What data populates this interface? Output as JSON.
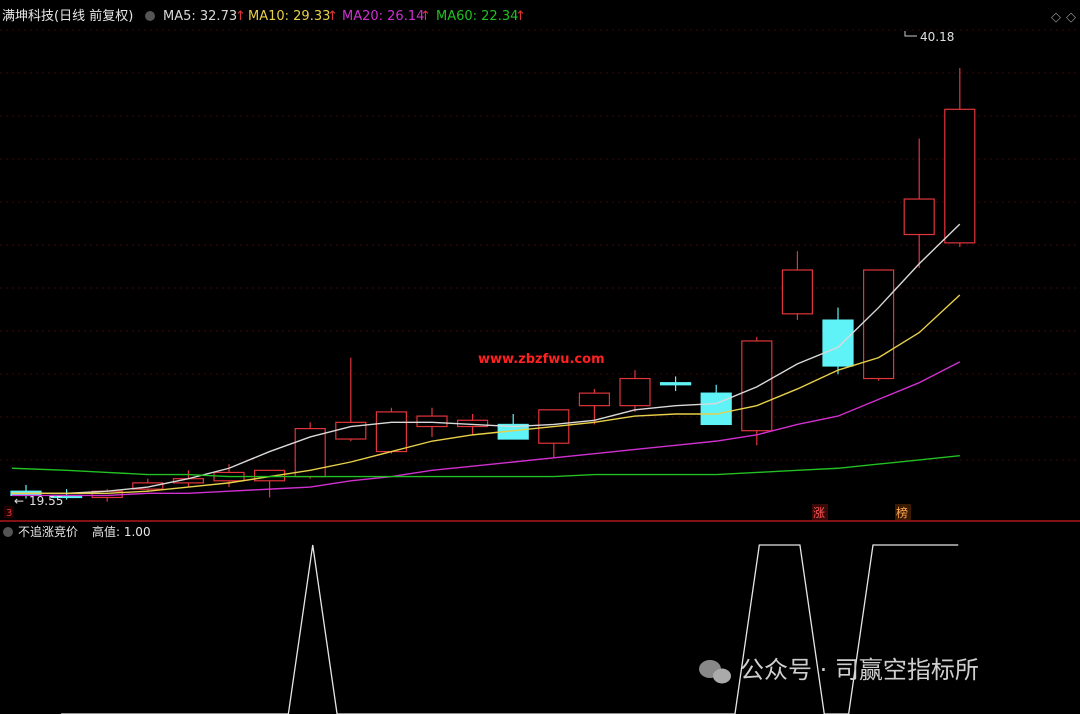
{
  "header": {
    "stock_title": "满坤科技(日线 前复权)",
    "ma5_label": "MA5: 32.73",
    "ma10_label": "MA10: 29.33",
    "ma20_label": "MA20: 26.14",
    "ma60_label": "MA60: 22.34",
    "up_arrow": "↑"
  },
  "labels": {
    "high_price": "40.18",
    "low_price": "19.55",
    "watermark_site": "www.zbzfwu.com",
    "tag_zhang": "涨",
    "tag_bang": "榜",
    "left_marker": "3"
  },
  "indicator": {
    "title": "不追涨竞价",
    "value_label": "高值: 1.00"
  },
  "watermark": {
    "text": "公众号 · 司赢空指标所"
  },
  "colors": {
    "up": "#e0353a",
    "down": "#5ff3f7",
    "ma5": "#d9d9d9",
    "ma10": "#e8d04a",
    "ma20": "#d030d0",
    "ma60": "#22c022",
    "indicator_line": "#e6e6e6",
    "grid": "#7a1010"
  },
  "chart_data": {
    "type": "candlestick",
    "price_range": [
      19.0,
      42.0
    ],
    "candles": [
      {
        "o": 19.9,
        "h": 20.2,
        "l": 19.55,
        "c": 19.7
      },
      {
        "o": 19.7,
        "h": 20.0,
        "l": 19.5,
        "c": 19.6
      },
      {
        "o": 19.6,
        "h": 20.0,
        "l": 19.4,
        "c": 19.9
      },
      {
        "o": 20.0,
        "h": 20.5,
        "l": 19.9,
        "c": 20.3
      },
      {
        "o": 20.3,
        "h": 20.9,
        "l": 20.1,
        "c": 20.5
      },
      {
        "o": 20.4,
        "h": 21.2,
        "l": 20.1,
        "c": 20.8
      },
      {
        "o": 20.4,
        "h": 20.9,
        "l": 19.6,
        "c": 20.9
      },
      {
        "o": 20.6,
        "h": 23.2,
        "l": 20.5,
        "c": 22.9
      },
      {
        "o": 22.4,
        "h": 26.3,
        "l": 22.3,
        "c": 23.2
      },
      {
        "o": 21.8,
        "h": 23.9,
        "l": 21.7,
        "c": 23.7
      },
      {
        "o": 23.0,
        "h": 23.9,
        "l": 22.5,
        "c": 23.5
      },
      {
        "o": 23.0,
        "h": 23.6,
        "l": 22.6,
        "c": 23.3
      },
      {
        "o": 23.1,
        "h": 23.6,
        "l": 22.5,
        "c": 22.4
      },
      {
        "o": 22.2,
        "h": 23.8,
        "l": 21.5,
        "c": 23.8
      },
      {
        "o": 24.0,
        "h": 24.8,
        "l": 23.1,
        "c": 24.6
      },
      {
        "o": 24.0,
        "h": 25.7,
        "l": 23.7,
        "c": 25.3
      },
      {
        "o": 25.1,
        "h": 25.4,
        "l": 24.7,
        "c": 25.0
      },
      {
        "o": 24.6,
        "h": 25.0,
        "l": 23.1,
        "c": 23.1
      },
      {
        "o": 22.8,
        "h": 27.3,
        "l": 22.1,
        "c": 27.1
      },
      {
        "o": 28.4,
        "h": 31.4,
        "l": 28.1,
        "c": 30.5
      },
      {
        "o": 28.1,
        "h": 28.7,
        "l": 25.5,
        "c": 25.9
      },
      {
        "o": 25.3,
        "h": 30.5,
        "l": 25.2,
        "c": 30.5
      },
      {
        "o": 32.2,
        "h": 36.8,
        "l": 30.6,
        "c": 33.9
      },
      {
        "o": 31.8,
        "h": 40.18,
        "l": 31.6,
        "c": 38.2
      }
    ],
    "ma": [
      {
        "name": "MA5",
        "color_key": "ma5",
        "values": [
          19.8,
          19.8,
          19.9,
          20.1,
          20.5,
          21.0,
          21.8,
          22.5,
          23.0,
          23.2,
          23.2,
          23.1,
          23.0,
          23.1,
          23.3,
          23.8,
          24.0,
          24.1,
          24.9,
          26.0,
          26.8,
          28.7,
          30.8,
          32.7
        ]
      },
      {
        "name": "MA10",
        "color_key": "ma10",
        "values": [
          19.8,
          19.8,
          19.8,
          19.9,
          20.1,
          20.3,
          20.6,
          20.9,
          21.3,
          21.8,
          22.3,
          22.6,
          22.8,
          23.0,
          23.2,
          23.5,
          23.6,
          23.6,
          24.0,
          24.8,
          25.7,
          26.3,
          27.5,
          29.3
        ]
      },
      {
        "name": "MA20",
        "color_key": "ma20",
        "values": [
          19.7,
          19.7,
          19.7,
          19.8,
          19.8,
          19.9,
          20.0,
          20.1,
          20.4,
          20.6,
          20.9,
          21.1,
          21.3,
          21.5,
          21.7,
          21.9,
          22.1,
          22.3,
          22.6,
          23.1,
          23.5,
          24.3,
          25.1,
          26.1
        ]
      },
      {
        "name": "MA60",
        "color_key": "ma60",
        "values": [
          21.0,
          20.9,
          20.8,
          20.7,
          20.7,
          20.6,
          20.6,
          20.6,
          20.6,
          20.6,
          20.6,
          20.6,
          20.6,
          20.6,
          20.7,
          20.7,
          20.7,
          20.7,
          20.8,
          20.9,
          21.0,
          21.2,
          21.4,
          21.6
        ]
      }
    ],
    "indicator_range": [
      0,
      1.0
    ],
    "indicator_points": [
      [
        0,
        0
      ],
      [
        1,
        0
      ],
      [
        2,
        0
      ],
      [
        3,
        0
      ],
      [
        4,
        0
      ],
      [
        5,
        0
      ],
      [
        5.6,
        0
      ],
      [
        6.2,
        1.0
      ],
      [
        6.8,
        0
      ],
      [
        7,
        0
      ],
      [
        8,
        0
      ],
      [
        9,
        0
      ],
      [
        10,
        0
      ],
      [
        11,
        0
      ],
      [
        12,
        0
      ],
      [
        13,
        0
      ],
      [
        14,
        0
      ],
      [
        15,
        0
      ],
      [
        16,
        0
      ],
      [
        16.6,
        0
      ],
      [
        17.2,
        1.0
      ],
      [
        18.2,
        1.0
      ],
      [
        18.8,
        0
      ],
      [
        19.4,
        0
      ],
      [
        20,
        1.0
      ],
      [
        21,
        1.0
      ],
      [
        22,
        1.0
      ],
      [
        22.1,
        1.0
      ]
    ]
  }
}
